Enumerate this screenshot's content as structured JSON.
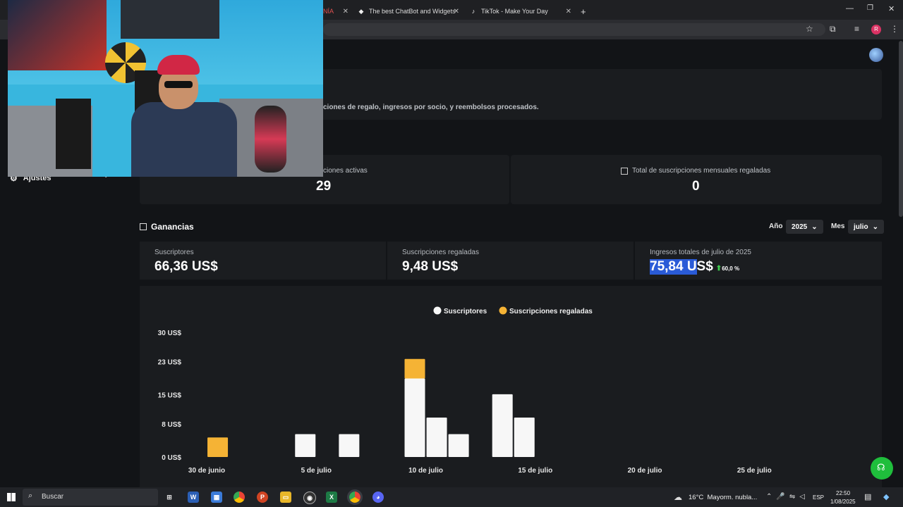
{
  "browser": {
    "tabs": [
      {
        "label": "NÍA",
        "suffix": "✕"
      },
      {
        "label": "The best ChatBot and Widgets"
      },
      {
        "label": "TikTok - Make Your Day"
      }
    ],
    "new_tab": "+",
    "window_controls": {
      "minimize": "—",
      "restore": "❐",
      "close": "✕"
    }
  },
  "sidebar": {
    "settings_label": "Ajustes"
  },
  "info": {
    "description": "ciones de regalo, ingresos por socio, y reembolsos procesados."
  },
  "subs_stats": {
    "active_label": "ciones activas",
    "active_value": "29",
    "gifted_label": "Total de suscripciones mensuales regaladas",
    "gifted_value": "0"
  },
  "earnings": {
    "title": "Ganancias",
    "year_label": "Año",
    "year_value": "2025",
    "month_label": "Mes",
    "month_value": "julio",
    "cards": [
      {
        "label": "Suscriptores",
        "value": "66,36 US$"
      },
      {
        "label": "Suscripciones regaladas",
        "value": "9,48 US$"
      },
      {
        "label": "Ingresos totales de julio de 2025",
        "value_highlight": "75,84 U",
        "value_rest": "S$",
        "change": "60,0 %"
      }
    ]
  },
  "chart_data": {
    "type": "bar",
    "stacked": true,
    "legend_position": "top-center",
    "series": [
      {
        "name": "Suscriptores",
        "color": "#f7f7f7",
        "values": [
          0,
          0,
          0,
          0,
          0,
          5.5,
          0,
          5.5,
          0,
          0,
          18.9,
          9.5,
          5.5,
          0,
          15.1,
          9.5,
          0,
          0,
          0,
          0,
          0,
          0,
          0,
          0,
          0,
          0,
          0,
          0,
          0,
          0,
          0,
          0
        ]
      },
      {
        "name": "Suscripciones regaladas",
        "color": "#f5b335",
        "values": [
          0,
          4.7,
          0,
          0,
          0,
          0,
          0,
          0,
          0,
          0,
          4.7,
          0,
          0,
          0,
          0,
          0,
          0,
          0,
          0,
          0,
          0,
          0,
          0,
          0,
          0,
          0,
          0,
          0,
          0,
          0,
          0,
          0
        ]
      }
    ],
    "y_ticks": [
      "30 US$",
      "23 US$",
      "15 US$",
      "8 US$",
      "0 US$"
    ],
    "y_tick_values": [
      30,
      23,
      15,
      8,
      0
    ],
    "ylim": [
      0,
      30
    ],
    "x_tick_labels": [
      "30 de junio",
      "5 de julio",
      "10 de julio",
      "15 de julio",
      "20 de julio",
      "25 de julio"
    ],
    "x_tick_index": [
      1,
      6,
      11,
      16,
      21,
      26
    ],
    "grid": false
  },
  "taskbar": {
    "search_placeholder": "Buscar",
    "weather": "16°C  Mayorm. nubla...",
    "lang": "ESP",
    "time": "22:50",
    "date": "1/08/2025"
  }
}
